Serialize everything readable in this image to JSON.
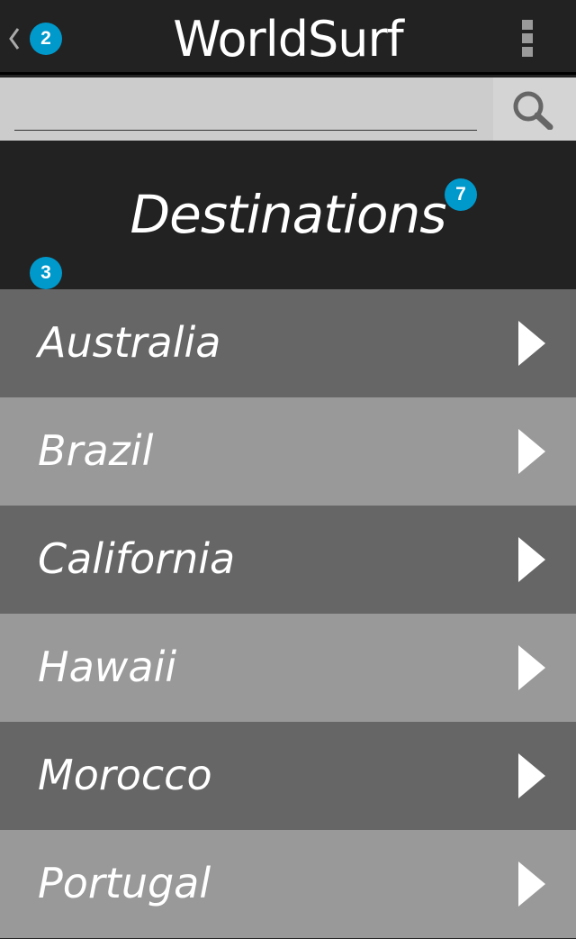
{
  "app": {
    "title": "WorldSurf"
  },
  "badges": {
    "back": "2",
    "section": "7",
    "list": "3"
  },
  "search": {
    "value": "",
    "placeholder": ""
  },
  "section": {
    "title": "Destinations"
  },
  "destinations": [
    {
      "label": "Australia"
    },
    {
      "label": "Brazil"
    },
    {
      "label": "California"
    },
    {
      "label": "Hawaii"
    },
    {
      "label": "Morocco"
    },
    {
      "label": "Portugal"
    }
  ],
  "colors": {
    "background": "#222222",
    "row_dark": "#666666",
    "row_light": "#999999",
    "search_bar": "#cccccc",
    "badge": "#0099cc"
  },
  "icons": {
    "back": "back-chevron-icon",
    "menu": "overflow-menu-icon",
    "search": "search-icon",
    "row": "chevron-right-icon"
  }
}
